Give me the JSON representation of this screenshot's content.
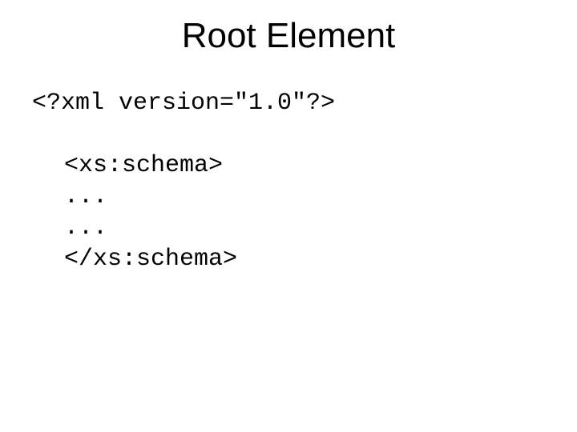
{
  "title": "Root Element",
  "code": {
    "line1": "<?xml version=\"1.0\"?>",
    "line2": "<xs:schema>",
    "line3": "...",
    "line4": "...",
    "line5": "</xs:schema>"
  }
}
